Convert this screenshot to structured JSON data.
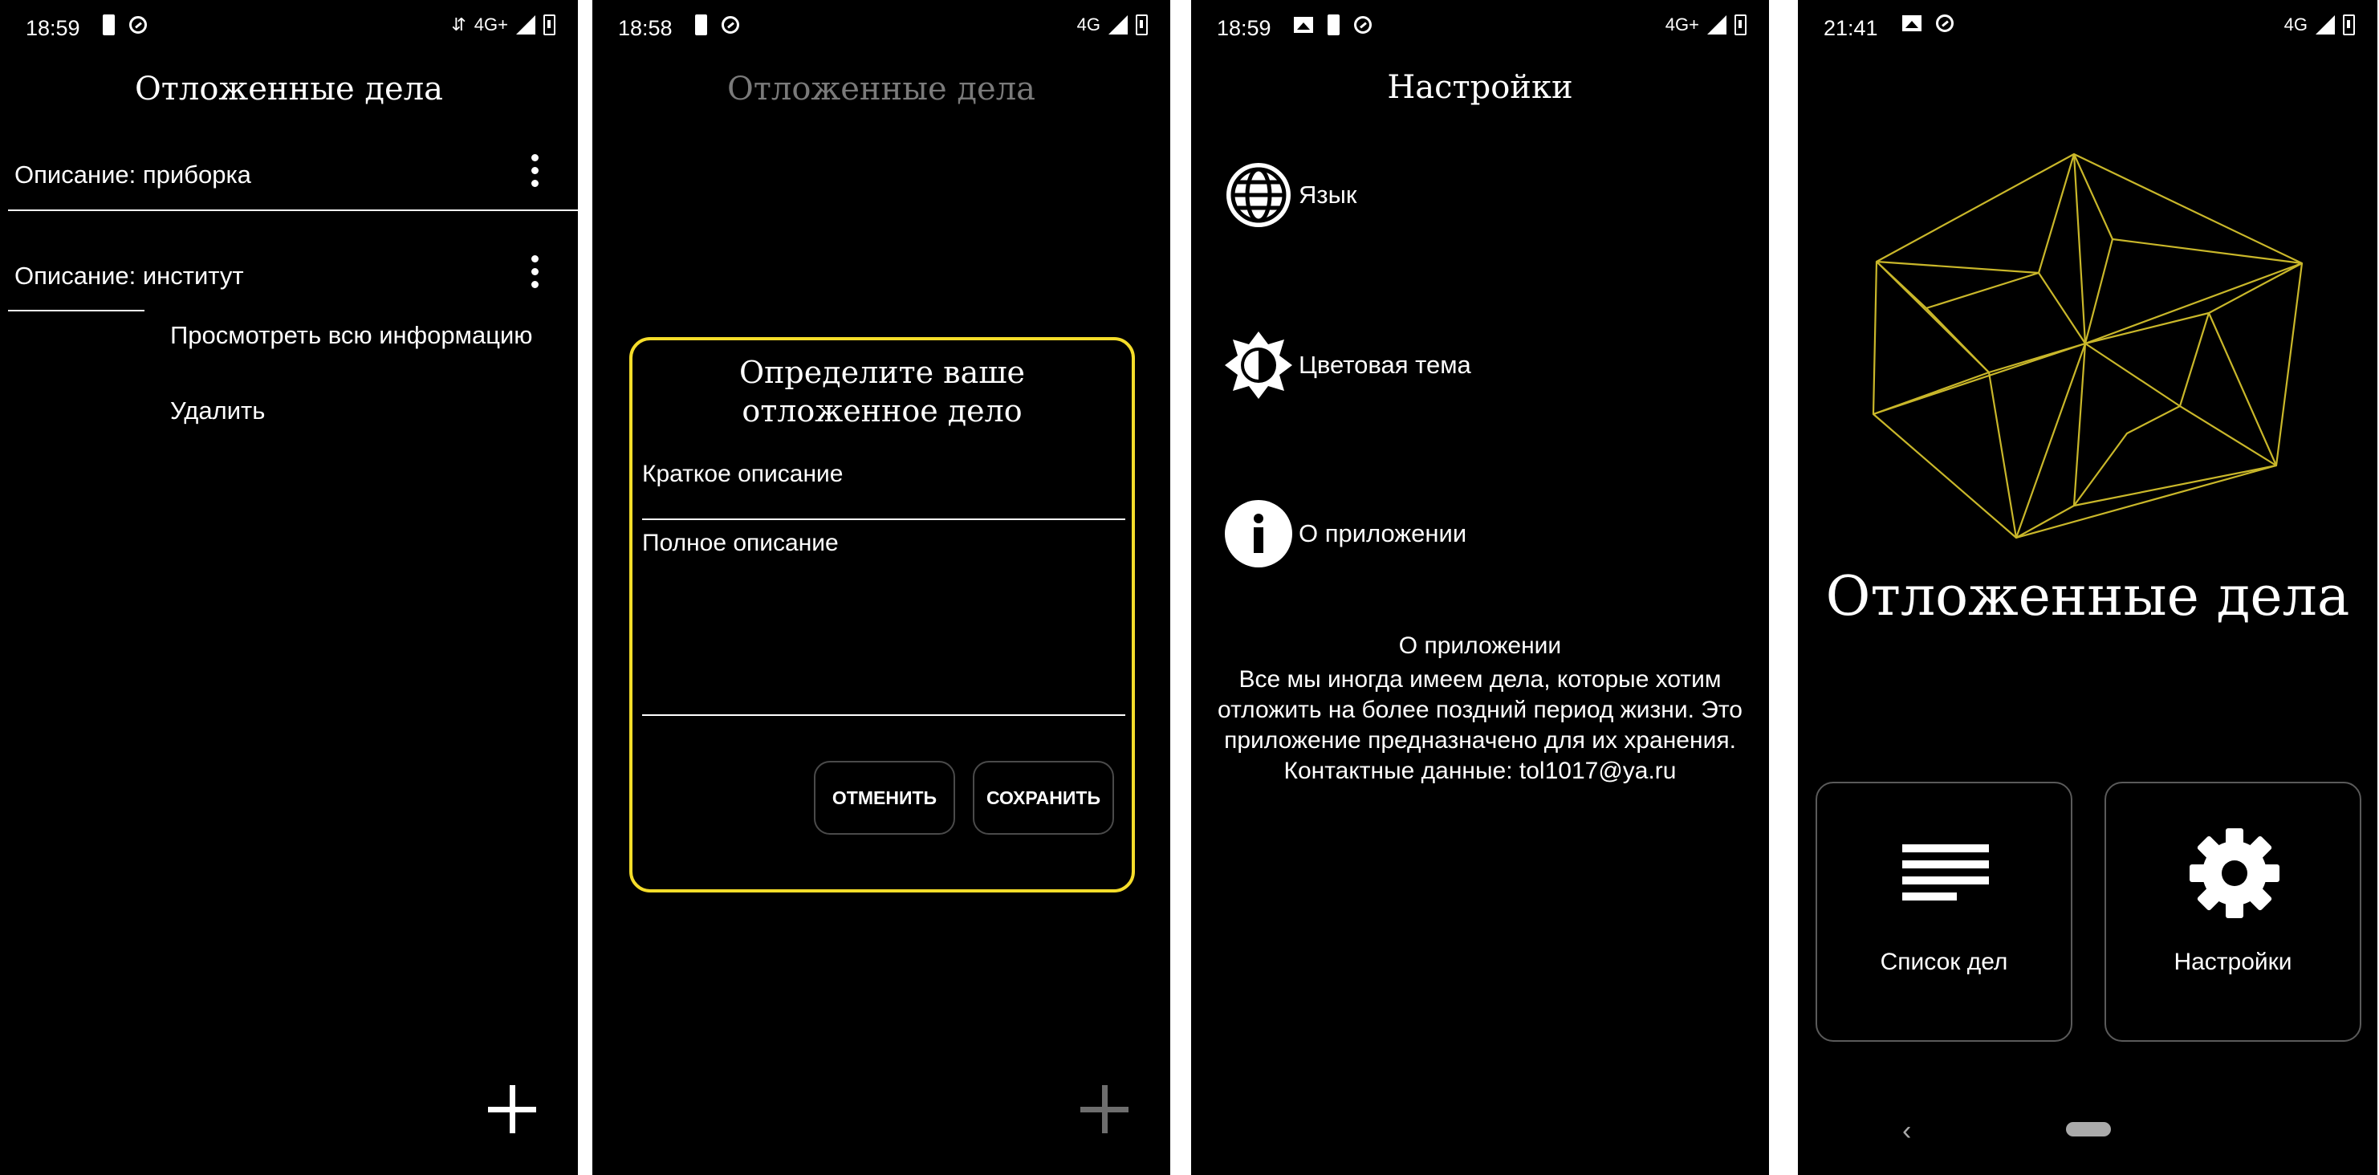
{
  "colors": {
    "background": "#000000",
    "accent": "#f5dd2a",
    "text": "#ffffff",
    "muted": "#7a7a7a"
  },
  "screen1": {
    "status": {
      "time": "18:59",
      "network": "4G+"
    },
    "title": "Отложенные дела",
    "items": [
      {
        "label": "Описание: приборка"
      },
      {
        "label": "Описание: институт"
      }
    ],
    "menu": {
      "view_all": "Просмотреть всю информацию",
      "delete": "Удалить"
    }
  },
  "screen2": {
    "status": {
      "time": "18:58",
      "network": "4G"
    },
    "title": "Отложенные дела",
    "dialog": {
      "title_line1": "Определите ваше",
      "title_line2": "отложенное дело",
      "short_placeholder": "Краткое описание",
      "full_placeholder": "Полное описание",
      "cancel": "ОТМЕНИТЬ",
      "save": "СОХРАНИТЬ"
    }
  },
  "screen3": {
    "status": {
      "time": "18:59",
      "network": "4G+"
    },
    "title": "Настройки",
    "items": [
      {
        "label": "Язык",
        "icon": "globe-icon"
      },
      {
        "label": "Цветовая тема",
        "icon": "brightness-icon"
      },
      {
        "label": "О приложении",
        "icon": "info-icon"
      }
    ],
    "about": {
      "heading": "О приложении",
      "lines": [
        "Все мы иногда имеем дела, которые хотим",
        "отложить на более поздний период жизни. Это",
        "приложение предназначено для их хранения.",
        "Контактные данные: tol1017@ya.ru"
      ]
    }
  },
  "screen4": {
    "status": {
      "time": "21:41",
      "network": "4G"
    },
    "app_title": "Отложенные дела",
    "tiles": [
      {
        "label": "Список дел",
        "icon": "list-icon"
      },
      {
        "label": "Настройки",
        "icon": "gear-icon"
      }
    ]
  }
}
